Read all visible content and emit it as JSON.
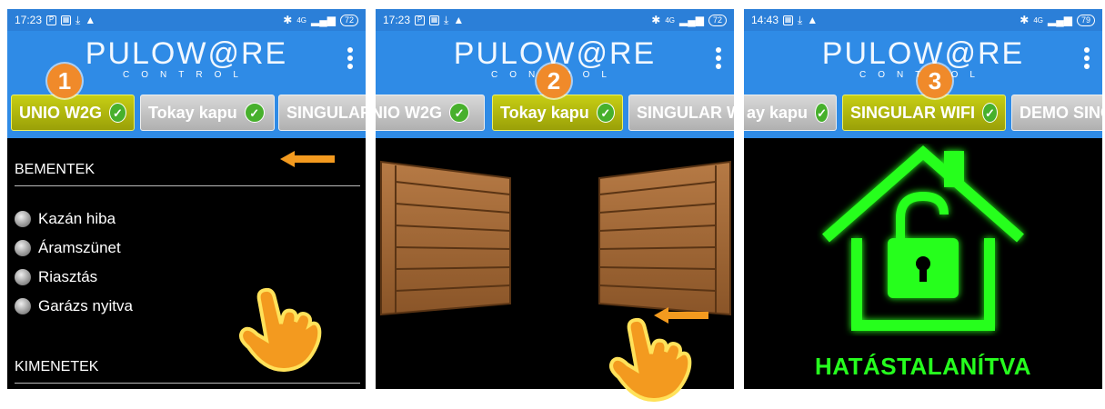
{
  "screens": [
    {
      "status": {
        "time": "17:23",
        "network": "4G",
        "battery": "72"
      },
      "badge": "1",
      "tabs": [
        {
          "label": "UNIO W2G",
          "active": true
        },
        {
          "label": "Tokay kapu",
          "active": false
        },
        {
          "label": "SINGULAR",
          "active": false
        }
      ],
      "inputs_title": "BEMENTEK",
      "inputs": [
        "Kazán hiba",
        "Áramszünet",
        "Riasztás",
        "Garázs nyitva"
      ],
      "outputs_title": "KIMENETEK"
    },
    {
      "status": {
        "time": "17:23",
        "network": "4G",
        "battery": "72"
      },
      "badge": "2",
      "tabs": [
        {
          "label": "NIO W2G",
          "active": false
        },
        {
          "label": "Tokay kapu",
          "active": true
        },
        {
          "label": "SINGULAR W",
          "active": false
        }
      ]
    },
    {
      "status": {
        "time": "14:43",
        "network": "4G",
        "battery": "79"
      },
      "badge": "3",
      "tabs": [
        {
          "label": "ay kapu",
          "active": false
        },
        {
          "label": "SINGULAR WIFI",
          "active": true
        },
        {
          "label": "DEMO SING",
          "active": false
        }
      ],
      "state_label": "HATÁSTALANÍTVA"
    }
  ],
  "logo": {
    "brand": "PULOW@RE",
    "sub": "CONTROL"
  },
  "colors": {
    "header": "#2f8be6",
    "active_tab": "#b8bf10",
    "check": "#47b02c",
    "badge": "#f08a2a",
    "house": "#26ff1e",
    "arrow": "#f39a1f"
  }
}
